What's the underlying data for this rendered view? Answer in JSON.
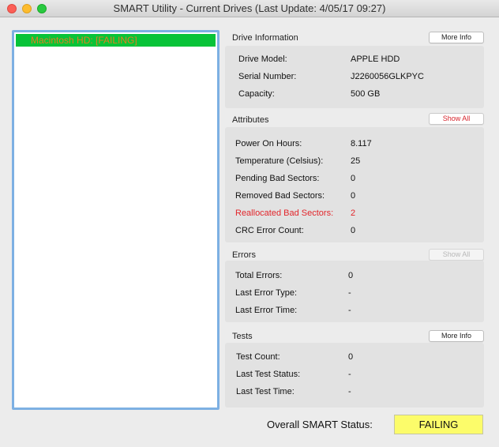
{
  "window": {
    "title": "SMART Utility - Current Drives (Last Update: 4/05/17 09:27)"
  },
  "drives": [
    {
      "label": "Macintosh HD: [FAILING]"
    }
  ],
  "drive_information": {
    "title": "Drive Information",
    "button": "More Info",
    "rows": [
      {
        "label": "Drive Model:",
        "value": "APPLE HDD"
      },
      {
        "label": "Serial Number:",
        "value": "J2260056GLKPYC"
      },
      {
        "label": "Capacity:",
        "value": "500 GB"
      }
    ]
  },
  "attributes": {
    "title": "Attributes",
    "button": "Show All",
    "rows": [
      {
        "label": "Power On Hours:",
        "value": "8.117"
      },
      {
        "label": "Temperature (Celsius):",
        "value": "25"
      },
      {
        "label": "Pending Bad Sectors:",
        "value": "0"
      },
      {
        "label": "Removed Bad Sectors:",
        "value": "0"
      },
      {
        "label": "Reallocated Bad Sectors:",
        "value": "2"
      },
      {
        "label": "CRC Error Count:",
        "value": "0"
      }
    ]
  },
  "errors": {
    "title": "Errors",
    "button": "Show All",
    "rows": [
      {
        "label": "Total Errors:",
        "value": "0"
      },
      {
        "label": "Last Error Type:",
        "value": "-"
      },
      {
        "label": "Last Error Time:",
        "value": "-"
      }
    ]
  },
  "tests": {
    "title": "Tests",
    "button": "More Info",
    "rows": [
      {
        "label": "Test Count:",
        "value": "0"
      },
      {
        "label": "Last Test Status:",
        "value": "-"
      },
      {
        "label": "Last Test Time:",
        "value": "-"
      }
    ]
  },
  "overall": {
    "label": "Overall SMART Status:",
    "status": "FAILING"
  },
  "colors": {
    "failing_highlight": "#08c338",
    "failing_text": "#e08020",
    "warning_red": "#e2262b",
    "status_yellow": "#fcfc6a",
    "list_border": "#7db0e3"
  }
}
